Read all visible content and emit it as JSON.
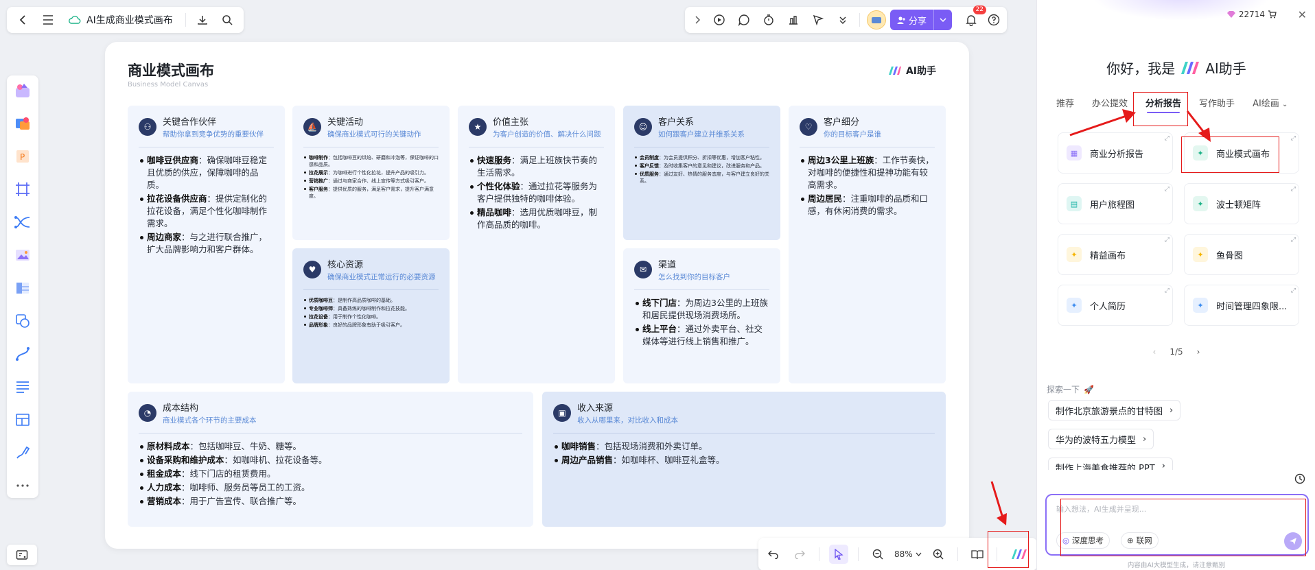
{
  "topbar": {
    "title": "AI生成商业模式画布"
  },
  "share": {
    "label": "分享",
    "notifications": "22"
  },
  "canvas": {
    "title": "商业模式画布",
    "subtitle": "Business Model Canvas",
    "ai_badge": "AI助手",
    "sections": {
      "partners": {
        "title": "关键合作伙伴",
        "subtitle": "帮助你拿到竞争优势的重要伙伴",
        "items": [
          {
            "k": "咖啡豆供应商",
            "v": "：确保咖啡豆稳定且优质的供应，保障咖啡的品质。"
          },
          {
            "k": "拉花设备供应商",
            "v": "：提供定制化的拉花设备，满足个性化咖啡制作需求。"
          },
          {
            "k": "周边商家",
            "v": "：与之进行联合推广，扩大品牌影响力和客户群体。"
          }
        ]
      },
      "activities": {
        "title": "关键活动",
        "subtitle": "确保商业模式可行的关键动作",
        "items": [
          {
            "k": "咖啡制作",
            "v": "：包括咖啡豆的烘焙、研磨和冲泡等，保证咖啡的口感和品质。"
          },
          {
            "k": "拉花展示",
            "v": "：为咖啡进行个性化拉花，提升产品的吸引力。"
          },
          {
            "k": "营销推广",
            "v": "：通过与商家合作、线上宣传等方式吸引客户。"
          },
          {
            "k": "客户服务",
            "v": "：提供优质的服务，满足客户需求，提升客户满意度。"
          }
        ]
      },
      "resources": {
        "title": "核心资源",
        "subtitle": "确保商业模式正常运行的必要资源",
        "items": [
          {
            "k": "优质咖啡豆",
            "v": "：是制作高品质咖啡的基础。"
          },
          {
            "k": "专业咖啡师",
            "v": "：具备熟练的咖啡制作和拉花技能。"
          },
          {
            "k": "拉花设备",
            "v": "：用于制作个性化咖啡。"
          },
          {
            "k": "品牌形象",
            "v": "：良好的品牌形象有助于吸引客户。"
          }
        ]
      },
      "value": {
        "title": "价值主张",
        "subtitle": "为客户创造的价值、解决什么问题",
        "items": [
          {
            "k": "快速服务",
            "v": "：满足上班族快节奏的生活需求。"
          },
          {
            "k": "个性化体验",
            "v": "：通过拉花等服务为客户提供独特的咖啡体验。"
          },
          {
            "k": "精品咖啡",
            "v": "：选用优质咖啡豆，制作高品质的咖啡。"
          }
        ]
      },
      "relations": {
        "title": "客户关系",
        "subtitle": "如何跟客户建立并维系关系",
        "items": [
          {
            "k": "会员制度",
            "v": "：为会员提供积分、折扣等优惠，增加客户粘性。"
          },
          {
            "k": "客户反馈",
            "v": "：及时收集客户的意见和建议，改进服务和产品。"
          },
          {
            "k": "优质服务",
            "v": "：通过友好、热情的服务态度，与客户建立良好的关系。"
          }
        ]
      },
      "channels": {
        "title": "渠道",
        "subtitle": "怎么找到你的目标客户",
        "items": [
          {
            "k": "线下门店",
            "v": "：为周边3公里的上班族和居民提供现场消费场所。"
          },
          {
            "k": "线上平台",
            "v": "：通过外卖平台、社交媒体等进行线上销售和推广。"
          }
        ]
      },
      "segments": {
        "title": "客户细分",
        "subtitle": "你的目标客户是谁",
        "items": [
          {
            "k": "周边3公里上班族",
            "v": "：工作节奏快，对咖啡的便捷性和提神功能有较高需求。"
          },
          {
            "k": "周边居民",
            "v": "：注重咖啡的品质和口感，有休闲消费的需求。"
          }
        ]
      },
      "cost": {
        "title": "成本结构",
        "subtitle": "商业模式各个环节的主要成本",
        "items": [
          {
            "k": "原材料成本",
            "v": "：包括咖啡豆、牛奶、糖等。"
          },
          {
            "k": "设备采购和维护成本",
            "v": "：如咖啡机、拉花设备等。"
          },
          {
            "k": "租金成本",
            "v": "：线下门店的租赁费用。"
          },
          {
            "k": "人力成本",
            "v": "：咖啡师、服务员等员工的工资。"
          },
          {
            "k": "营销成本",
            "v": "：用于广告宣传、联合推广等。"
          }
        ]
      },
      "revenue": {
        "title": "收入来源",
        "subtitle": "收入从哪里来，对比收入和成本",
        "items": [
          {
            "k": "咖啡销售",
            "v": "：包括现场消费和外卖订单。"
          },
          {
            "k": "周边产品销售",
            "v": "：如咖啡杯、咖啡豆礼盒等。"
          }
        ]
      }
    }
  },
  "bottombar": {
    "zoom": "88%"
  },
  "panel": {
    "credits": "22714",
    "greeting": "你好，我是",
    "assistant_name": "AI助手",
    "tabs": [
      "推荐",
      "办公提效",
      "分析报告",
      "写作助手",
      "AI绘画"
    ],
    "cards": [
      {
        "label": "商业分析报告",
        "icon": "grid-icon",
        "color": "#8b6ff7"
      },
      {
        "label": "商业模式画布",
        "icon": "sparkle-icon",
        "color": "#1db388"
      },
      {
        "label": "用户旅程图",
        "icon": "chart-icon",
        "color": "#19b3a6"
      },
      {
        "label": "波士顿矩阵",
        "icon": "sparkle-icon",
        "color": "#1db388"
      },
      {
        "label": "精益画布",
        "icon": "sparkle-icon",
        "color": "#f5b400"
      },
      {
        "label": "鱼骨图",
        "icon": "sparkle-icon",
        "color": "#f5b400"
      },
      {
        "label": "个人简历",
        "icon": "sparkle-icon",
        "color": "#3c8cf0"
      },
      {
        "label": "时间管理四象限...",
        "icon": "sparkle-icon",
        "color": "#3c8cf0"
      }
    ],
    "pager": "1/5",
    "explore_label": "探索一下",
    "suggestions": [
      "制作北京旅游景点的甘特图",
      "华为的波特五力模型",
      "制作上海美食推荐的 PPT"
    ],
    "input_placeholder": "输入想法，AI生成并呈现...",
    "chip_deep": "深度思考",
    "chip_web": "联网",
    "footnote": "内容由AI大模型生成，请注意甄别"
  }
}
